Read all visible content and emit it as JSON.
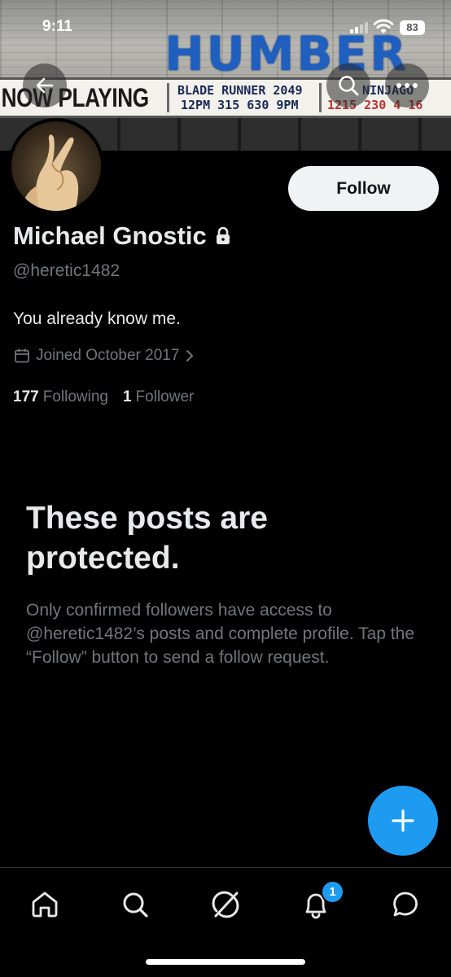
{
  "status_bar": {
    "time": "9:11",
    "battery": "83"
  },
  "banner": {
    "marquee_title": "HUMBER",
    "now_playing": "NOW PLAYING",
    "movie1_title": "BLADE  RUNNER 2049",
    "movie1_times": "12PM 315 630  9PM",
    "movie2_title": "NINJAGO",
    "movie2_times": "1215 230 4 16"
  },
  "profile": {
    "name": "Michael Gnostic",
    "handle": "@heretic1482",
    "bio": "You already know me.",
    "joined": "Joined October 2017",
    "following_count": "177",
    "following_label": "Following",
    "followers_count": "1",
    "followers_label": "Follower"
  },
  "actions": {
    "follow_label": "Follow"
  },
  "protected": {
    "title": "These posts are protected.",
    "body": "Only confirmed followers have access to @heretic1482’s posts and complete profile. Tap the “Follow” button to send a follow request."
  },
  "tab_bar": {
    "items": [
      "home-icon",
      "search-icon",
      "grok-icon",
      "bell-icon",
      "messages-icon"
    ],
    "notification_count": "1"
  },
  "colors": {
    "accent": "#1d9bf0",
    "background": "#000000",
    "muted_text": "#71767b"
  }
}
